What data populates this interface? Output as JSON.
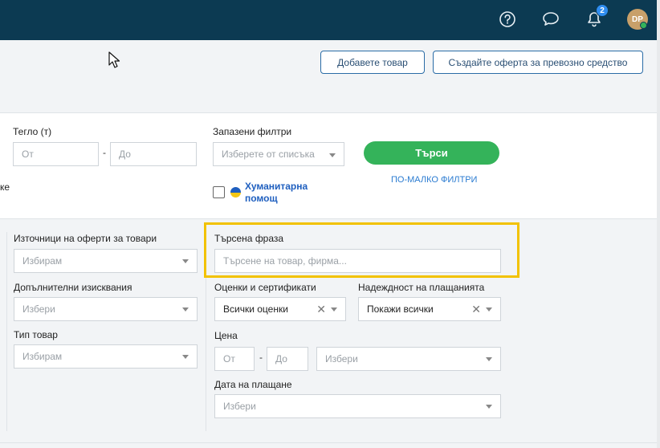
{
  "header": {
    "notification_count": "2",
    "avatar_initials": "DP",
    "icons": [
      "help-icon",
      "chat-icon",
      "bell-icon"
    ]
  },
  "toolbar": {
    "add_goods_label": "Добавете товар",
    "create_vehicle_offer_label": "Създайте оферта за превозно средство"
  },
  "filters": {
    "weight_label": "Тегло (т)",
    "weight_from_placeholder": "От",
    "weight_to_placeholder": "До",
    "weight_separator": "-",
    "saved_filters_label": "Запазени филтри",
    "saved_filters_placeholder": "Изберете от списъка",
    "search_button_label": "Търси",
    "fewer_filters_label": "ПО-МАЛКО ФИЛТРИ",
    "humanitarian_label": "Хуманитарна помощ",
    "cut_off_left_text": "ке"
  },
  "advanced": {
    "sources_label": "Източници на оферти за товари",
    "sources_placeholder": "Избирам",
    "requirements_label": "Допълнителни изисквания",
    "requirements_placeholder": "Избери",
    "goods_type_label": "Тип товар",
    "goods_type_placeholder": "Избирам",
    "search_phrase_label": "Търсена фраза",
    "search_phrase_placeholder": "Търсене на товар, фирма...",
    "ratings_label": "Оценки и сертификати",
    "ratings_value": "Всички оценки",
    "payment_reliability_label": "Надеждност на плащанията",
    "payment_reliability_value": "Покажи всички",
    "price_label": "Цена",
    "price_from_placeholder": "От",
    "price_to_placeholder": "До",
    "price_separator": "-",
    "price_currency_placeholder": "Избери",
    "payment_date_label": "Дата на плащане",
    "payment_date_placeholder": "Избери"
  },
  "colors": {
    "header_bg": "#0c3a52",
    "search_button": "#34b35a",
    "highlight": "#f2c200",
    "link": "#2a7bd1"
  }
}
